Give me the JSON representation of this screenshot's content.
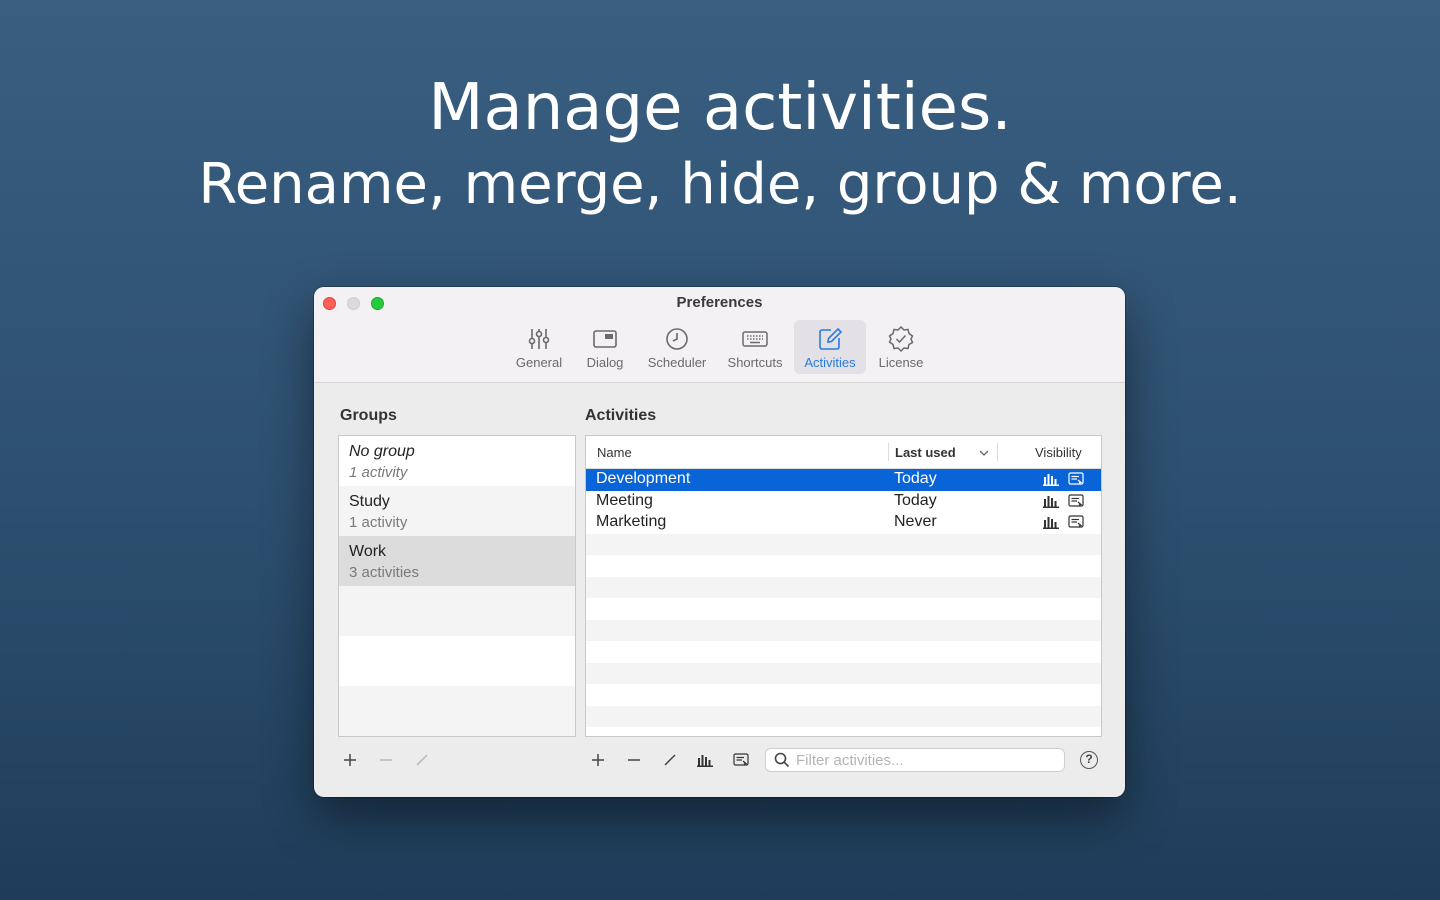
{
  "marketing": {
    "headline": "Manage activities.",
    "subheadline": "Rename, merge, hide, group & more."
  },
  "window": {
    "title": "Preferences"
  },
  "toolbar": {
    "tabs": [
      {
        "label": "General",
        "icon": "sliders-icon"
      },
      {
        "label": "Dialog",
        "icon": "dialog-window-icon"
      },
      {
        "label": "Scheduler",
        "icon": "clock-icon"
      },
      {
        "label": "Shortcuts",
        "icon": "keyboard-icon"
      },
      {
        "label": "Activities",
        "icon": "edit-square-icon",
        "active": true
      },
      {
        "label": "License",
        "icon": "checkmark-seal-icon"
      }
    ]
  },
  "groups": {
    "label": "Groups",
    "items": [
      {
        "name": "No group",
        "count": "1 activity",
        "italic": true
      },
      {
        "name": "Study",
        "count": "1 activity"
      },
      {
        "name": "Work",
        "count": "3 activities",
        "selected": true
      }
    ]
  },
  "activities": {
    "label": "Activities",
    "columns": {
      "name": "Name",
      "last_used": "Last used",
      "visibility": "Visibility"
    },
    "rows": [
      {
        "name": "Development",
        "last_used": "Today",
        "selected": true
      },
      {
        "name": "Meeting",
        "last_used": "Today"
      },
      {
        "name": "Marketing",
        "last_used": "Never"
      }
    ],
    "search_placeholder": "Filter activities...",
    "help_label": "?"
  },
  "colors": {
    "accent": "#2a7ae2",
    "selection": "#0964d8",
    "close": "#fe5f57",
    "maximize": "#28c840"
  }
}
